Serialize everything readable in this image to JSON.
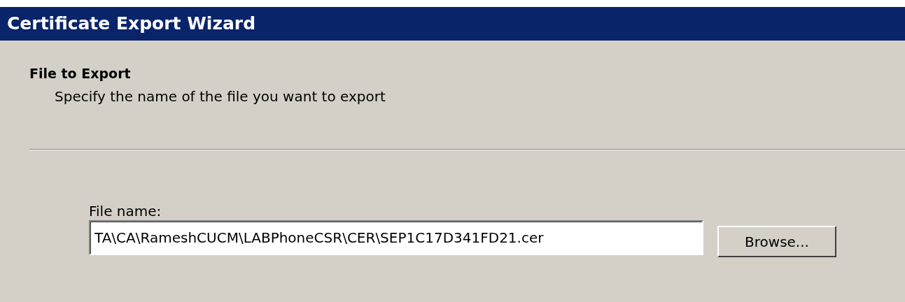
{
  "window": {
    "title": "Certificate Export Wizard"
  },
  "header": {
    "title": "File to Export",
    "subtitle": "Specify the name of the file you want to export"
  },
  "file_name": {
    "label": "File name:",
    "value": "TA\\CA\\RameshCUCM\\LABPhoneCSR\\CER\\SEP1C17D341FD21.cer"
  },
  "buttons": [
    "Browse..."
  ]
}
